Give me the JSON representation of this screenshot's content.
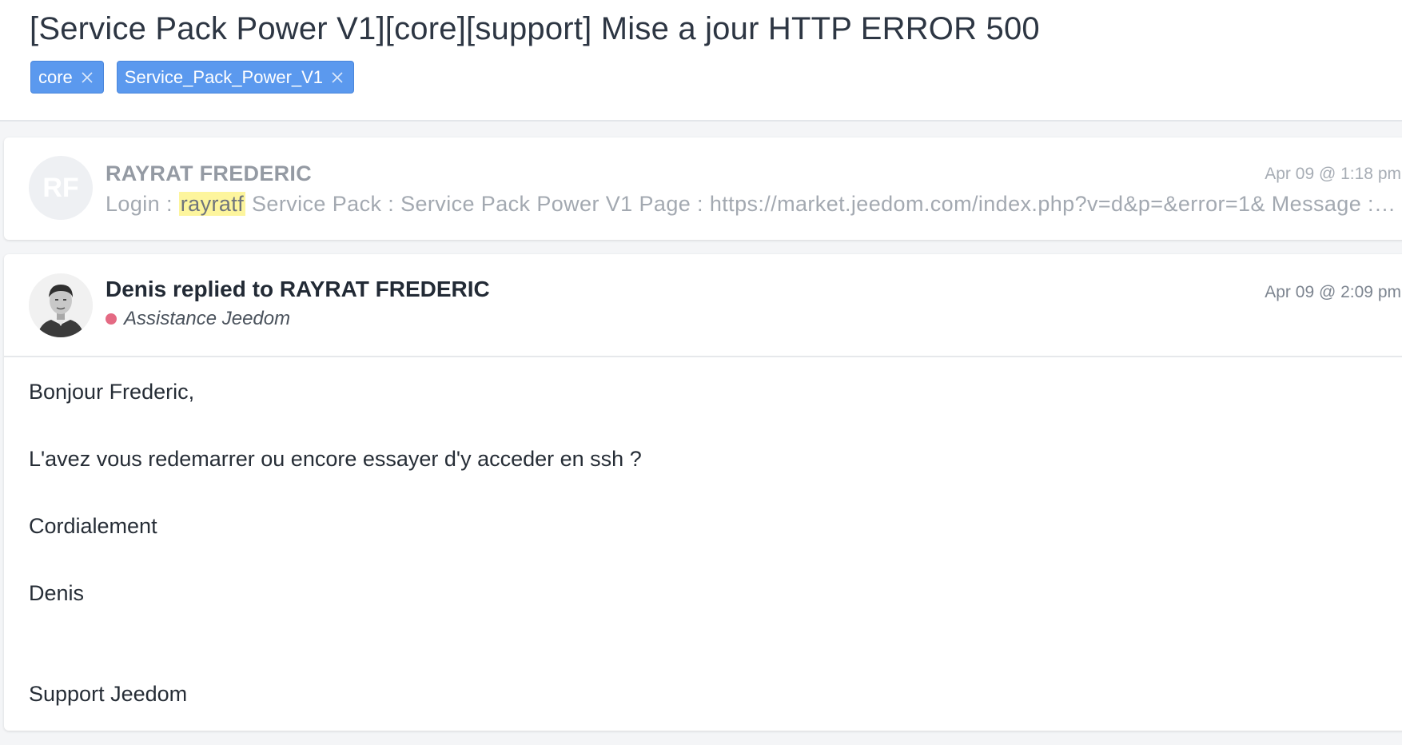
{
  "ticket": {
    "title": "[Service Pack Power V1][core][support] Mise a jour HTTP ERROR 500",
    "tags": [
      "core",
      "Service_Pack_Power_V1"
    ]
  },
  "message1": {
    "initials": "RF",
    "sender": "RAYRAT FREDERIC",
    "date": "Apr 09 @ 1:18 pm",
    "preview_prefix": "Login : ",
    "preview_highlight": "rayratf",
    "preview_rest": " Service Pack : Service Pack Power V1 Page : https://market.jeedom.com/index.php?v=d&p=&error=1& Message : Bonjour, depuis la mise à jour"
  },
  "message2": {
    "header": "Denis replied to RAYRAT FREDERIC",
    "org": "Assistance Jeedom",
    "date": "Apr 09 @ 2:09 pm",
    "body": {
      "greeting": "Bonjour Frederic,",
      "question": "L'avez vous redemarrer ou encore essayer d'y acceder en ssh ?",
      "closing": "Cordialement",
      "name": "Denis",
      "signature": "Support Jeedom"
    }
  },
  "colors": {
    "tag": "#5b99ee",
    "highlight": "#fdf59d",
    "status_dot": "#e46a83"
  },
  "icons": [
    "tag-remove-icon",
    "user-avatar-photo"
  ]
}
